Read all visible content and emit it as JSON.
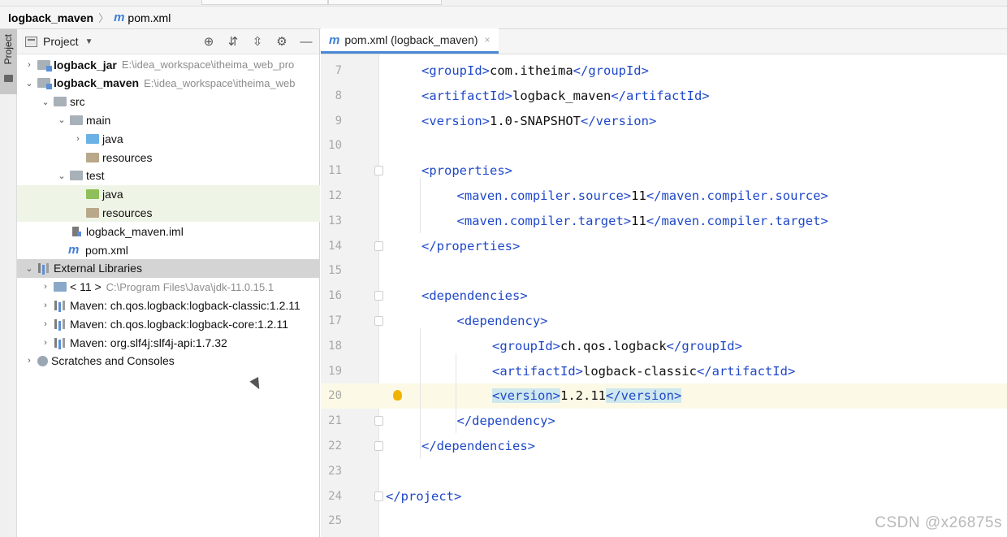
{
  "breadcrumb": {
    "project": "logback_maven",
    "file": "pom.xml",
    "file_icon": "m"
  },
  "tool_window_strip": {
    "label": "Project"
  },
  "project_panel": {
    "header_label": "Project",
    "tools": [
      "locate-icon",
      "expand-all-icon",
      "collapse-all-icon",
      "gear-icon",
      "minimize-icon"
    ],
    "tree": [
      {
        "label": "logback_jar",
        "path": "E:\\idea_workspace\\itheima_web_pro",
        "indent": 0,
        "chevron": "›",
        "icon": "mod",
        "bold": true
      },
      {
        "label": "logback_maven",
        "path": "E:\\idea_workspace\\itheima_web",
        "indent": 0,
        "chevron": "⌄",
        "icon": "mod",
        "bold": true
      },
      {
        "label": "src",
        "indent": 1,
        "chevron": "⌄",
        "icon": "gray"
      },
      {
        "label": "main",
        "indent": 2,
        "chevron": "⌄",
        "icon": "gray"
      },
      {
        "label": "java",
        "indent": 3,
        "chevron": "›",
        "icon": "blue"
      },
      {
        "label": "resources",
        "indent": 3,
        "chevron": "",
        "icon": "res"
      },
      {
        "label": "test",
        "indent": 2,
        "chevron": "⌄",
        "icon": "gray"
      },
      {
        "label": "java",
        "indent": 3,
        "chevron": "",
        "icon": "green",
        "highlight": true
      },
      {
        "label": "resources",
        "indent": 3,
        "chevron": "",
        "icon": "res",
        "highlight": true
      },
      {
        "label": "logback_maven.iml",
        "indent": 2,
        "chevron": "",
        "icon": "iml"
      },
      {
        "label": "pom.xml",
        "indent": 2,
        "chevron": "",
        "icon": "m"
      },
      {
        "label": "External Libraries",
        "indent": 0,
        "chevron": "⌄",
        "icon": "libbar",
        "selected": true
      },
      {
        "label": "< 11 >",
        "path": "C:\\Program Files\\Java\\jdk-11.0.15.1",
        "indent": 1,
        "chevron": "›",
        "icon": "jdk"
      },
      {
        "label": "Maven: ch.qos.logback:logback-classic:1.2.11",
        "indent": 1,
        "chevron": "›",
        "icon": "libbar"
      },
      {
        "label": "Maven: ch.qos.logback:logback-core:1.2.11",
        "indent": 1,
        "chevron": "›",
        "icon": "libbar"
      },
      {
        "label": "Maven: org.slf4j:slf4j-api:1.7.32",
        "indent": 1,
        "chevron": "›",
        "icon": "libbar"
      },
      {
        "label": "Scratches and Consoles",
        "indent": 0,
        "chevron": "›",
        "icon": "scratch"
      }
    ]
  },
  "editor": {
    "tab": {
      "icon": "m",
      "label": "pom.xml (logback_maven)",
      "close": "×"
    },
    "current_line": 20,
    "lines": [
      {
        "n": "7",
        "indent": 1,
        "parts": [
          [
            "t",
            "<groupId>"
          ],
          [
            "p",
            "com.itheima"
          ],
          [
            "t",
            "</groupId>"
          ]
        ]
      },
      {
        "n": "8",
        "indent": 1,
        "parts": [
          [
            "t",
            "<artifactId>"
          ],
          [
            "p",
            "logback_maven"
          ],
          [
            "t",
            "</artifactId>"
          ]
        ]
      },
      {
        "n": "9",
        "indent": 1,
        "parts": [
          [
            "t",
            "<version>"
          ],
          [
            "p",
            "1.0-SNAPSHOT"
          ],
          [
            "t",
            "</version>"
          ]
        ]
      },
      {
        "n": "10",
        "indent": 0,
        "parts": []
      },
      {
        "n": "11",
        "indent": 1,
        "fold": true,
        "parts": [
          [
            "t",
            "<properties>"
          ]
        ]
      },
      {
        "n": "12",
        "indent": 2,
        "parts": [
          [
            "t",
            "<maven.compiler.source>"
          ],
          [
            "p",
            "11"
          ],
          [
            "t",
            "</maven.compiler.source>"
          ]
        ]
      },
      {
        "n": "13",
        "indent": 2,
        "parts": [
          [
            "t",
            "<maven.compiler.target>"
          ],
          [
            "p",
            "11"
          ],
          [
            "t",
            "</maven.compiler.target>"
          ]
        ]
      },
      {
        "n": "14",
        "indent": 1,
        "fold": true,
        "parts": [
          [
            "t",
            "</properties>"
          ]
        ]
      },
      {
        "n": "15",
        "indent": 0,
        "parts": []
      },
      {
        "n": "16",
        "indent": 1,
        "fold": true,
        "parts": [
          [
            "t",
            "<dependencies>"
          ]
        ]
      },
      {
        "n": "17",
        "indent": 2,
        "fold": true,
        "parts": [
          [
            "t",
            "<dependency>"
          ]
        ]
      },
      {
        "n": "18",
        "indent": 3,
        "parts": [
          [
            "t",
            "<groupId>"
          ],
          [
            "p",
            "ch.qos.logback"
          ],
          [
            "t",
            "</groupId>"
          ]
        ]
      },
      {
        "n": "19",
        "indent": 3,
        "parts": [
          [
            "t",
            "<artifactId>"
          ],
          [
            "p",
            "logback-classic"
          ],
          [
            "t",
            "</artifactId>"
          ]
        ]
      },
      {
        "n": "20",
        "indent": 3,
        "bulb": true,
        "parts": [
          [
            "th",
            "<version>"
          ],
          [
            "p",
            "1.2.11"
          ],
          [
            "th",
            "</version>"
          ]
        ]
      },
      {
        "n": "21",
        "indent": 2,
        "fold": true,
        "parts": [
          [
            "t",
            "</dependency>"
          ]
        ]
      },
      {
        "n": "22",
        "indent": 1,
        "fold": true,
        "parts": [
          [
            "t",
            "</dependencies>"
          ]
        ]
      },
      {
        "n": "23",
        "indent": 0,
        "parts": []
      },
      {
        "n": "24",
        "indent": 0,
        "fold": true,
        "parts": [
          [
            "t",
            "</project>"
          ]
        ]
      },
      {
        "n": "25",
        "indent": 0,
        "parts": []
      }
    ]
  },
  "watermark": "CSDN @x26875s",
  "colors": {
    "tag": "#1f48c8",
    "accent": "#4a88d6",
    "maven_icon": "#3c7fd6",
    "highlight_row": "#eef5e6",
    "current_line": "#fcfae6"
  }
}
